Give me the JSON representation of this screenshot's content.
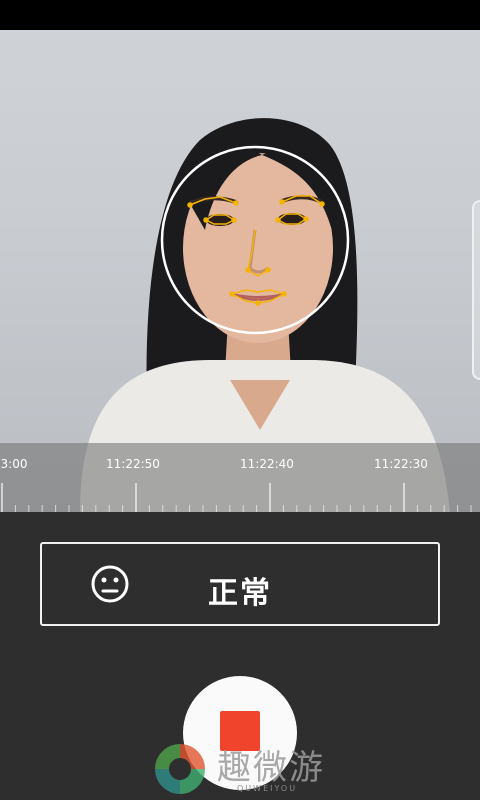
{
  "timeline": {
    "labels": [
      "3:00",
      "11:22:50",
      "11:22:40",
      "11:22:30"
    ]
  },
  "mode": {
    "label": "正常",
    "icon": "neutral-face-icon"
  },
  "record": {
    "icon": "stop-icon",
    "color": "#f0442c"
  },
  "watermark": {
    "text": "趣微游",
    "sub": "QUWEIYOU"
  },
  "colors": {
    "panel": "#2e2e2e",
    "landmark": "#f5b400",
    "face_circle": "#ffffff"
  }
}
